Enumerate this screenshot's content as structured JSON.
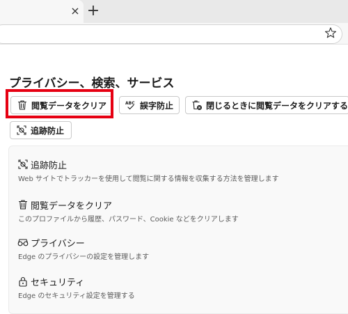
{
  "tabbar": {
    "close_glyph": "×",
    "new_tab_glyph": "+"
  },
  "page": {
    "title": "プライバシー、検索、サービス"
  },
  "chips": [
    {
      "label": "閲覧データをクリア",
      "icon": "trash-icon"
    },
    {
      "label": "誤字防止",
      "icon": "spellcheck-icon"
    },
    {
      "label": "閉じるときに閲覧データをクリアする",
      "icon": "trash-close-icon"
    },
    {
      "label": "追跡防止",
      "icon": "tracking-prevention-icon"
    }
  ],
  "items": [
    {
      "label": "追跡防止",
      "desc": "Web サイトでトラッカーを使用して閲覧に関する情報を収集する方法を管理します",
      "icon": "tracking-prevention-icon"
    },
    {
      "label": "閲覧データをクリア",
      "desc": "このプロファイルから履歴、パスワード、Cookie などをクリアします",
      "icon": "trash-icon"
    },
    {
      "label": "プライバシー",
      "desc": "Edge のプライバシーの設定を管理します",
      "icon": "glasses-icon"
    },
    {
      "label": "セキュリティ",
      "desc": "Edge のセキュリティ設定を管理する",
      "icon": "lock-icon"
    }
  ],
  "colors": {
    "highlight": "#e60012",
    "panel_bg": "#f9f9f9"
  }
}
